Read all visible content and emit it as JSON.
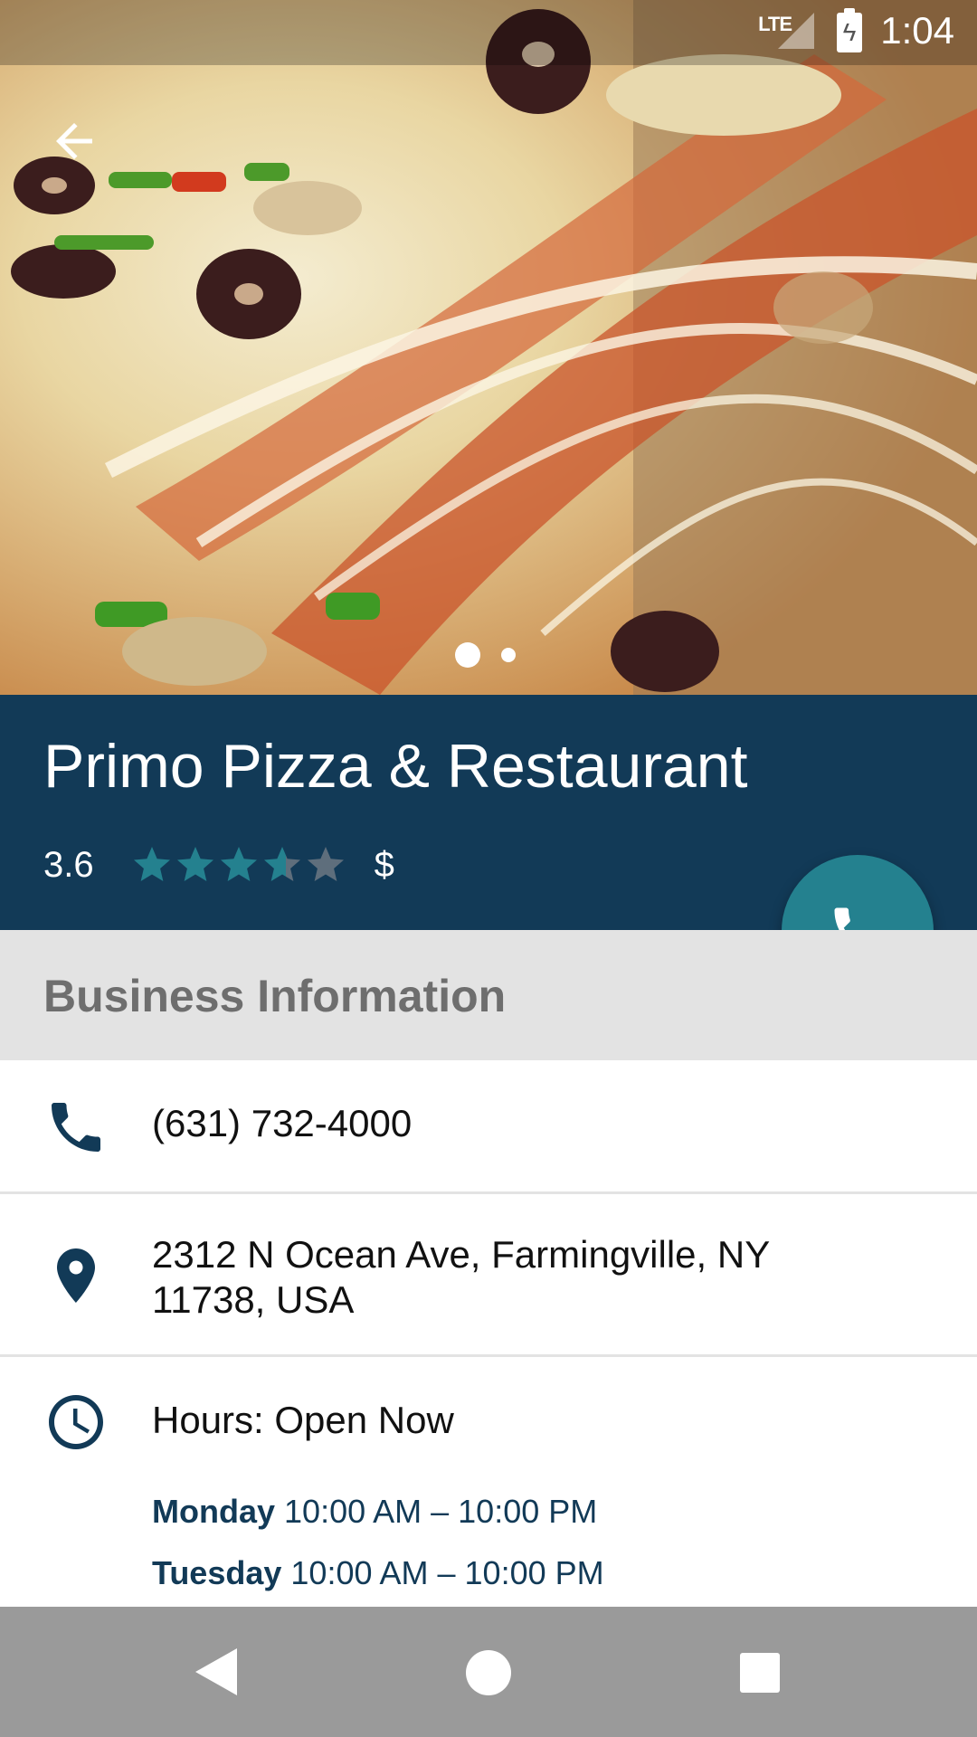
{
  "status_bar": {
    "network": "LTE",
    "time": "1:04"
  },
  "hero": {
    "image_description_icon": "pizza-photo",
    "carousel_pages": 2,
    "carousel_active_index": 0
  },
  "restaurant": {
    "name": "Primo Pizza & Restaurant",
    "rating": "3.6",
    "rating_value": 3.6,
    "rating_max": 5,
    "price_level": "$"
  },
  "colors": {
    "primary": "#123a57",
    "accent": "#24818f",
    "star_filled": "#24818f",
    "star_empty": "#5e6e7c"
  },
  "section": {
    "title": "Business Information"
  },
  "info": {
    "phone": "(631) 732-4000",
    "address": "2312 N Ocean Ave, Farmingville, NY 11738, USA",
    "hours_status": "Hours: Open Now",
    "hours": [
      {
        "day": "Monday",
        "time": "10:00 AM – 10:00 PM"
      },
      {
        "day": "Tuesday",
        "time": "10:00 AM – 10:00 PM"
      }
    ]
  }
}
